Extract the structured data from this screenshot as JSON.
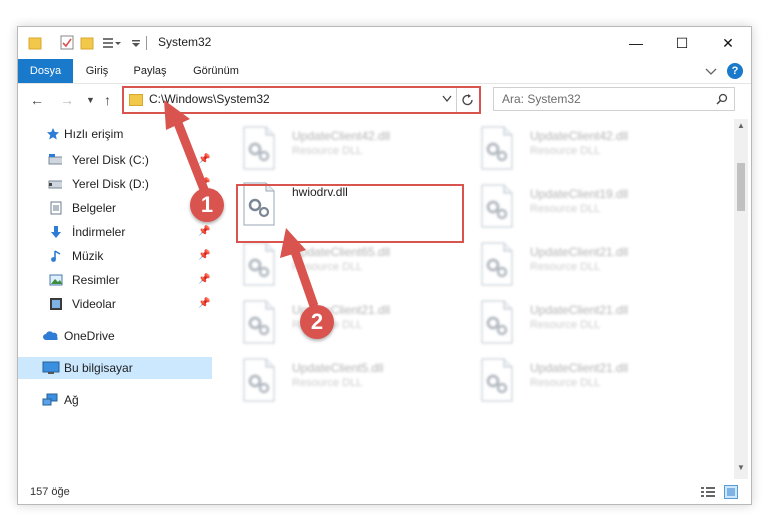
{
  "window": {
    "title": "System32",
    "controls": {
      "minimize": "—",
      "maximize": "☐",
      "close": "✕"
    }
  },
  "ribbon": {
    "tabs": [
      "Dosya",
      "Giriş",
      "Paylaş",
      "Görünüm"
    ],
    "help": "?"
  },
  "navigation": {
    "address": "C:\\Windows\\System32",
    "search_placeholder": "Ara: System32"
  },
  "sidebar": {
    "items": [
      {
        "label": "Hızlı erişim",
        "icon": "star-icon",
        "pinned": false
      },
      {
        "label": "Yerel Disk (C:)",
        "icon": "drive-icon",
        "pinned": true
      },
      {
        "label": "Yerel Disk (D:)",
        "icon": "drive-icon",
        "pinned": true
      },
      {
        "label": "Belgeler",
        "icon": "document-icon",
        "pinned": true
      },
      {
        "label": "İndirmeler",
        "icon": "download-icon",
        "pinned": true
      },
      {
        "label": "Müzik",
        "icon": "music-icon",
        "pinned": true
      },
      {
        "label": "Resimler",
        "icon": "pictures-icon",
        "pinned": true
      },
      {
        "label": "Videolar",
        "icon": "video-icon",
        "pinned": true
      },
      {
        "label": "OneDrive",
        "icon": "cloud-icon",
        "pinned": false
      },
      {
        "label": "Bu bilgisayar",
        "icon": "computer-icon",
        "pinned": false
      },
      {
        "label": "Ağ",
        "icon": "network-icon",
        "pinned": false
      }
    ]
  },
  "files": [
    {
      "name": "UpdateClient42.dll",
      "type": "Resource DLL"
    },
    {
      "name": "UpdateClient42.dll",
      "type": "Resource DLL"
    },
    {
      "name": "hwiodrv.dll",
      "type": ""
    },
    {
      "name": "UpdateClient19.dll",
      "type": "Resource DLL"
    },
    {
      "name": "UpdateClient65.dll",
      "type": "Resource DLL"
    },
    {
      "name": "UpdateClient21.dll",
      "type": "Resource DLL"
    },
    {
      "name": "UpdateClient21.dll",
      "type": "Resource DLL"
    },
    {
      "name": "UpdateClient21.dll",
      "type": "Resource DLL"
    },
    {
      "name": "UpdateClient5.dll",
      "type": "Resource DLL"
    },
    {
      "name": "UpdateClient21.dll",
      "type": "Resource DLL"
    }
  ],
  "status": {
    "count": "157 öğe"
  },
  "annotations": {
    "step1": "1",
    "step2": "2"
  },
  "colors": {
    "accent": "#1979ca",
    "highlight": "#d9534f",
    "selection": "#cce8ff"
  }
}
